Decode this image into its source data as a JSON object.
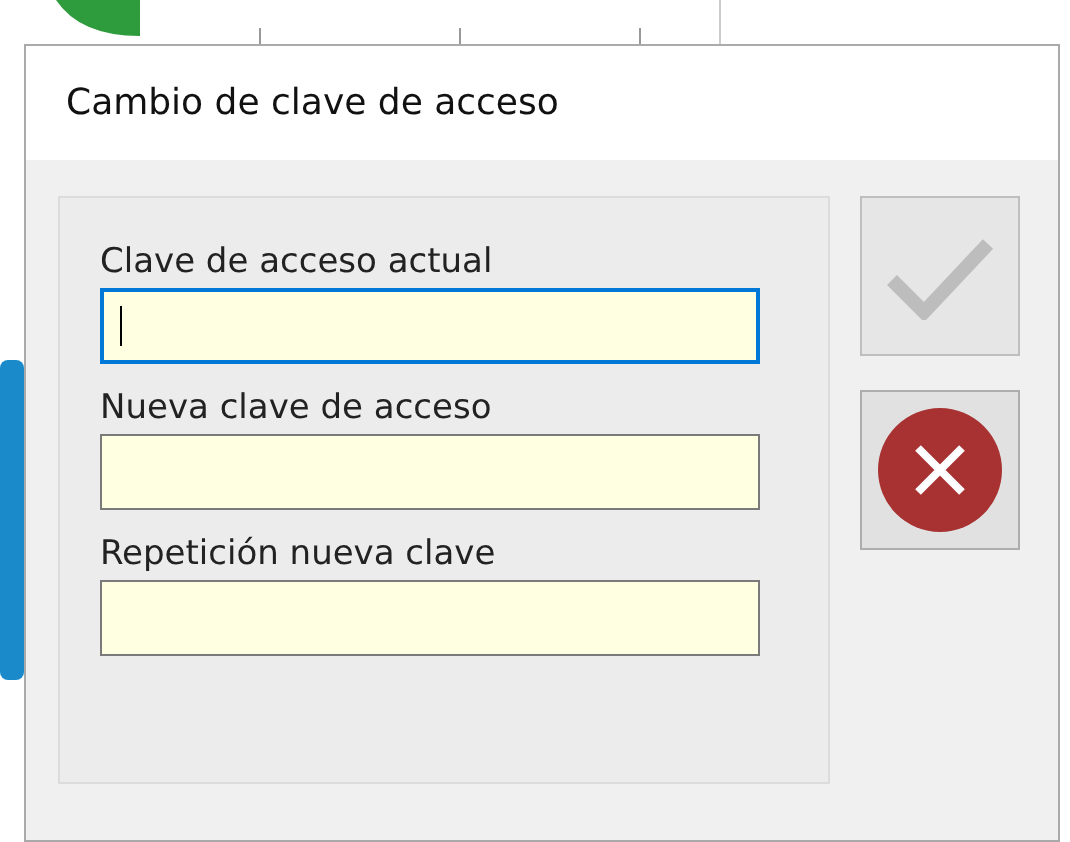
{
  "dialog": {
    "title": "Cambio de clave de acceso"
  },
  "fields": [
    {
      "label": "Clave de acceso actual",
      "focused": true
    },
    {
      "label": "Nueva clave de acceso",
      "focused": false
    },
    {
      "label": "Repetición nueva clave",
      "focused": false
    }
  ],
  "buttons": [
    {
      "kind": "accept",
      "disabled": true
    },
    {
      "kind": "cancel",
      "disabled": false
    }
  ]
}
